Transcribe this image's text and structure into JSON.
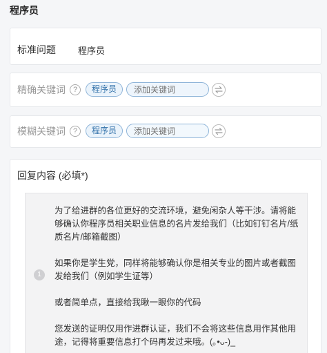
{
  "page": {
    "title": "程序员"
  },
  "standard_question": {
    "label": "标准问题",
    "value": "程序员"
  },
  "exact_keywords": {
    "label": "精确关键词",
    "help": "?",
    "tags": [
      "程序员"
    ],
    "add_placeholder": "添加关键词",
    "switch_icon": "swap-arrows-icon"
  },
  "fuzzy_keywords": {
    "label": "模糊关键词",
    "help": "?",
    "tags": [
      "程序员"
    ],
    "add_placeholder": "添加关键词",
    "switch_icon": "swap-arrows-icon"
  },
  "reply": {
    "label": "回复内容 (必填*)",
    "index": "1",
    "paragraphs": [
      "为了给进群的各位更好的交流环境，避免闲杂人等干涉。请将能够确认你程序员相关职业信息的名片发给我们（比如钉钉名片/纸质名片/邮箱截图）",
      "如果你是学生党，同样将能够确认你是相关专业的图片或者截图发给我们（例如学生证等）",
      "或者简单点，直接给我瞅一眼你的代码",
      "您发送的证明仅用作进群认证，我们不会将这些信息用作其他用途，记得将重要信息打个码再发过来哦。(｡•ᴗ-)_"
    ]
  },
  "colors": {
    "tag_border": "#8eb4d8",
    "tag_text": "#2f6fa8",
    "tag_bg": "#eaf3fb",
    "reply_bg": "#f3f3f4"
  }
}
